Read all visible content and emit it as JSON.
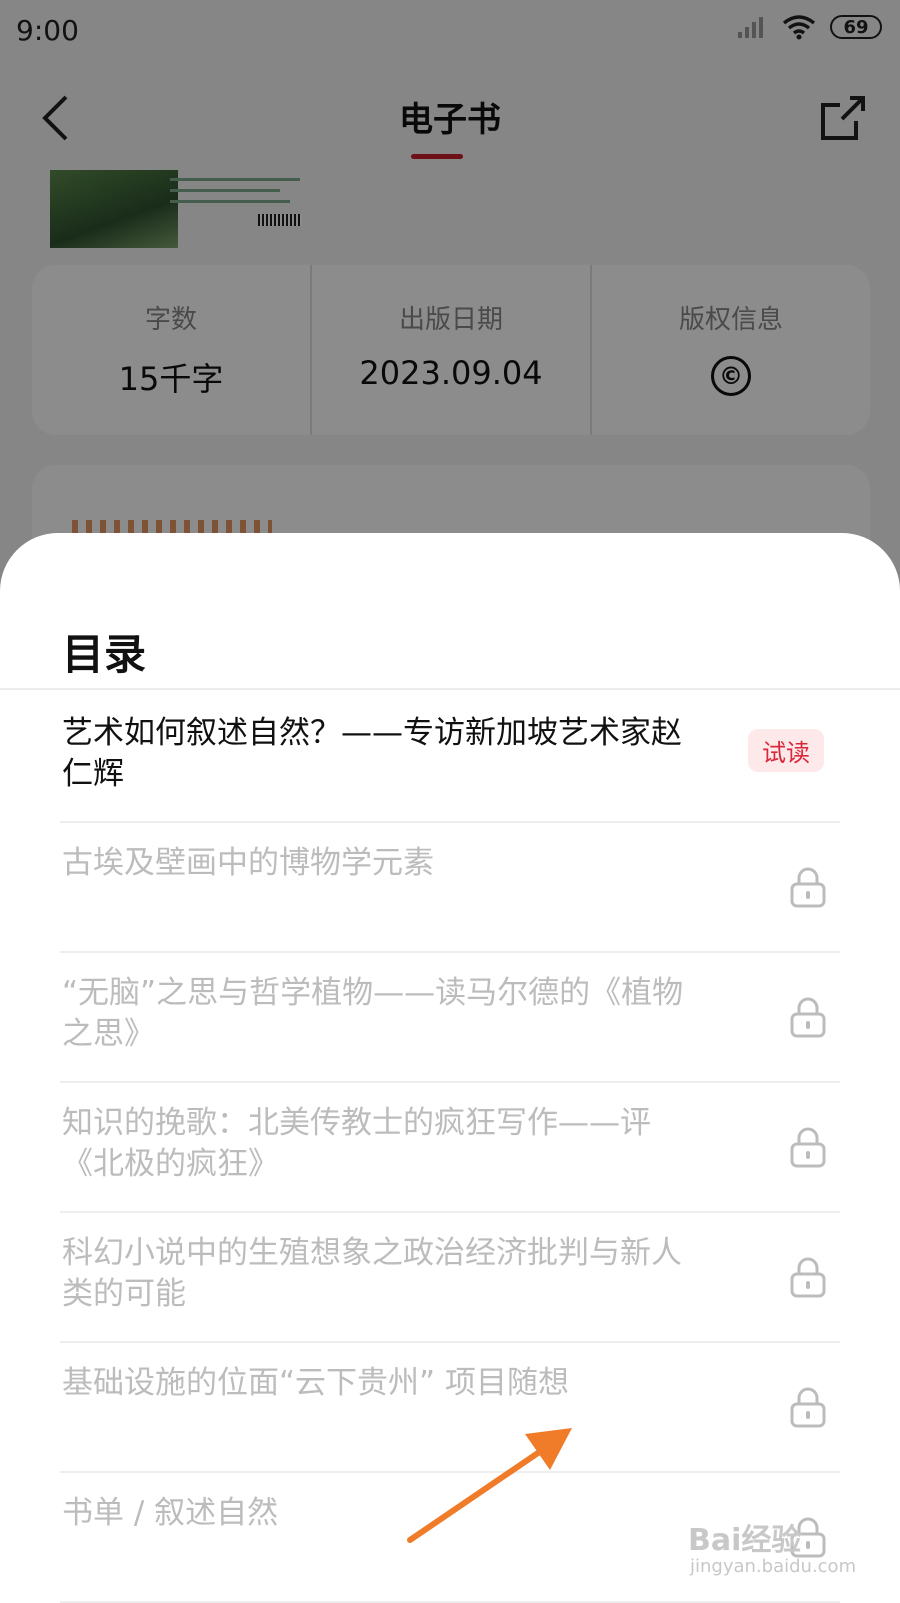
{
  "status_bar": {
    "time": "9:00",
    "battery": "69"
  },
  "header": {
    "title": "电子书"
  },
  "info": [
    {
      "label": "字数",
      "value": "15千字"
    },
    {
      "label": "出版日期",
      "value": "2023.09.04"
    },
    {
      "label": "版权信息",
      "value": "©"
    }
  ],
  "sheet": {
    "title": "目录",
    "items": [
      {
        "title": "艺术如何叙述自然？——专访新加坡艺术家赵仁辉",
        "badge": "试读",
        "locked": false
      },
      {
        "title": "古埃及壁画中的博物学元素",
        "locked": true
      },
      {
        "title": "“无脑”之思与哲学植物——读马尔德的《植物之思》",
        "locked": true
      },
      {
        "title": "知识的挽歌：北美传教士的疯狂写作——评《北极的疯狂》",
        "locked": true
      },
      {
        "title": "科幻小说中的生殖想象之政治经济批判与新人类的可能",
        "locked": true
      },
      {
        "title": "基础设施的位面“云下贵州” 项目随想",
        "locked": true
      },
      {
        "title": "书单 / 叙述自然",
        "locked": true
      }
    ]
  },
  "watermark": {
    "main": "Bai经验",
    "sub": "jingyan.baidu.com"
  },
  "colors": {
    "accent": "#c8202b",
    "trial_badge_bg": "#fde8ea",
    "trial_badge_text": "#d9283a",
    "arrow": "#f07c2a"
  },
  "icons": [
    "back-arrow-icon",
    "share-icon",
    "lock-icon",
    "copyright-icon",
    "signal-icon",
    "wifi-icon"
  ]
}
